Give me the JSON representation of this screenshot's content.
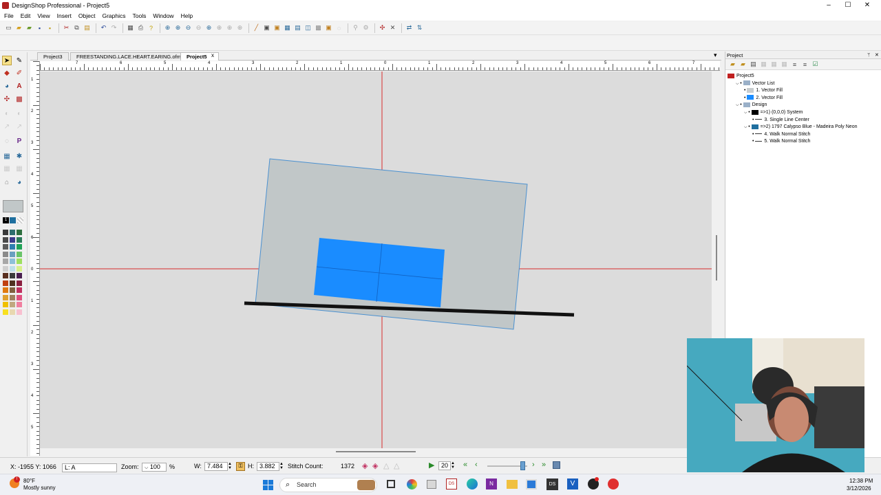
{
  "window": {
    "title": "DesignShop Professional - Project5",
    "minimize": "–",
    "maximize": "☐",
    "close": "✕"
  },
  "menu": [
    "File",
    "Edit",
    "View",
    "Insert",
    "Object",
    "Graphics",
    "Tools",
    "Window",
    "Help"
  ],
  "tabs": [
    {
      "label": "Project3",
      "active": false
    },
    {
      "label": "FREESTANDING.LACE.HEART.EARING.ofm",
      "active": false
    },
    {
      "label": "Project5",
      "active": true,
      "close": "x"
    }
  ],
  "tabbar_dropdown": "▾",
  "ruler": {
    "top_labels": [
      "7",
      "6",
      "5",
      "4",
      "3",
      "2",
      "1",
      "0",
      "1",
      "2",
      "3",
      "4",
      "5",
      "6",
      "7"
    ],
    "left_labels": [
      "1",
      "2",
      "3",
      "4",
      "5",
      "6",
      "0",
      "1",
      "2",
      "3",
      "4",
      "5"
    ]
  },
  "project_panel": {
    "title": "Project",
    "pin": "ᛘ",
    "close": "✕",
    "tree": [
      {
        "label": "Project5",
        "level": 0,
        "icon": "project-icon"
      },
      {
        "label": "Vector List",
        "level": 1,
        "icon": "vector-list-icon"
      },
      {
        "label": "1. Vector Fill",
        "level": 2,
        "swatch": "#c8cdcf"
      },
      {
        "label": "2. Vector Fill",
        "level": 2,
        "swatch": "#1a8cff"
      },
      {
        "label": "Design",
        "level": 1,
        "icon": "design-icon"
      },
      {
        "label": "=>1) (0,0,0) System",
        "level": 2,
        "swatch": "#000000"
      },
      {
        "label": "3. Single Line Center",
        "level": 3,
        "icon": "line-icon"
      },
      {
        "label": "=>2) 1797 Calypso Blue - Madeira Poly Neon",
        "level": 2,
        "swatch": "#1f6f9f"
      },
      {
        "label": "4. Walk Normal Stitch",
        "level": 3,
        "icon": "walk-icon"
      },
      {
        "label": "5. Walk Normal Stitch",
        "level": 3,
        "icon": "walk-icon"
      }
    ]
  },
  "status": {
    "coords": "X: -1955  Y: 1066",
    "layer": "L: A",
    "zoom_label": "Zoom:",
    "zoom_value": "100",
    "zoom_unit": "%",
    "w_label": "W:",
    "w_value": "7.484",
    "h_label": "H:",
    "h_value": "3.882",
    "stitch_label": "Stitch Count:",
    "stitch_value": "1372",
    "speed_value": "20"
  },
  "taskbar": {
    "weather_temp": "80°F",
    "weather_desc": "Mostly sunny",
    "search_placeholder": "Search",
    "time": "12:38 PM",
    "date": "3/12/2026"
  },
  "colors": {
    "background_rect": "#c1c7c8",
    "foreground_rect": "#1a8cff",
    "crosshair": "#d92b2b",
    "line": "#111111"
  },
  "palette": [
    [
      "#3a3a3a",
      "#2d6e6e",
      "#2e6f3f"
    ],
    [
      "#4a4a4a",
      "#3b3b8c",
      "#2a7a5a"
    ],
    [
      "#5c5c5c",
      "#2f7fb0",
      "#21a357"
    ],
    [
      "#8a8a8a",
      "#6aa0c0",
      "#6ac46a"
    ],
    [
      "#a8a8a8",
      "#8ec0d8",
      "#9ee060"
    ],
    [
      "#cfcfcf",
      "#bfe0ea",
      "#d8f08a"
    ],
    [
      "#5a3020",
      "#3b3b3b",
      "#4a2050"
    ],
    [
      "#c04010",
      "#503020",
      "#8a2040"
    ],
    [
      "#e07a10",
      "#806040",
      "#c03060"
    ],
    [
      "#e0a030",
      "#a08060",
      "#e05080"
    ],
    [
      "#f0c000",
      "#c0a880",
      "#f080a0"
    ],
    [
      "#f8e020",
      "#e8d8b0",
      "#f8c0d0"
    ]
  ]
}
